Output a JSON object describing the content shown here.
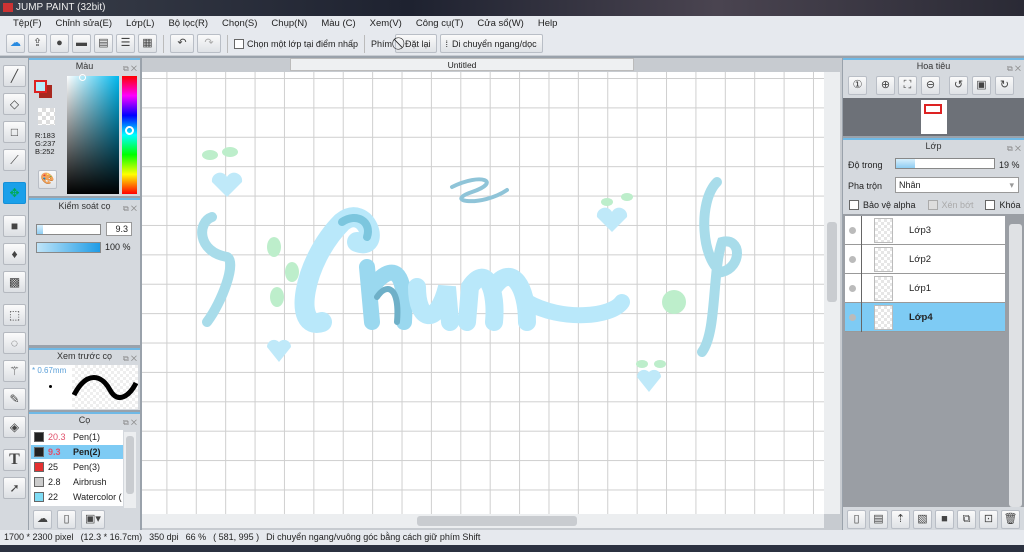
{
  "app": {
    "title": "JUMP PAINT (32bit)"
  },
  "menu": [
    "Tệp(F)",
    "Chỉnh sửa(E)",
    "Lớp(L)",
    "Bộ lọc(R)",
    "Chọn(S)",
    "Chụp(N)",
    "Màu (C)",
    "Xem(V)",
    "Công cụ(T)",
    "Cửa sổ(W)",
    "Help"
  ],
  "toolbar": {
    "select_layer_label": "Chọn một lớp tại điểm nhấp",
    "key_label": "Phím",
    "reset_label": "Đặt lại",
    "move_label": "Di chuyển ngang/dọc"
  },
  "color_panel": {
    "title": "Màu",
    "r": "R:183",
    "g": "G:237",
    "b": "B:252",
    "fg_color": "#b7edfc",
    "bg_color": "#a9281f"
  },
  "brush_control": {
    "title": "Kiểm soát cọ",
    "size": "9.3",
    "opacity": "100 %",
    "size_fraction": 0.1,
    "opacity_fraction": 1.0
  },
  "brush_preview": {
    "title": "Xem trước cọ",
    "size": "* 0.67mm"
  },
  "brushes": {
    "title": "Cọ",
    "items": [
      {
        "size": "20.3",
        "name": "Pen(1)",
        "color": "#222222"
      },
      {
        "size": "9.3",
        "name": "Pen(2)",
        "color": "#222222"
      },
      {
        "size": "25",
        "name": "Pen(3)",
        "color": "#e53030"
      },
      {
        "size": "2.8",
        "name": "Airbrush",
        "color": "#cccccc"
      },
      {
        "size": "22",
        "name": "Watercolor (",
        "color": "#7fdcf5"
      }
    ]
  },
  "canvas": {
    "tab": "Untitled"
  },
  "navigator": {
    "title": "Hoa tiêu"
  },
  "layers": {
    "title": "Lớp",
    "opacity_label": "Độ trong",
    "opacity": "19 %",
    "opacity_fraction": 0.19,
    "blend_label": "Pha trộn",
    "blend": "Nhân",
    "protect_alpha": "Bảo vệ alpha",
    "clip": "Xén bớt",
    "lock": "Khóa",
    "items": [
      {
        "name": "Lớp3"
      },
      {
        "name": "Lớp2"
      },
      {
        "name": "Lớp1"
      },
      {
        "name": "Lớp4",
        "selected": true
      }
    ]
  },
  "status": {
    "pixels": "1700 * 2300 pixel",
    "cm": "(12.3 * 16.7cm)",
    "dpi": "350 dpi",
    "zoom": "66 %",
    "coords": "( 581, 995 )",
    "hint": "Di chuyển ngang/vuông góc bằng cách giữ phím Shift"
  }
}
